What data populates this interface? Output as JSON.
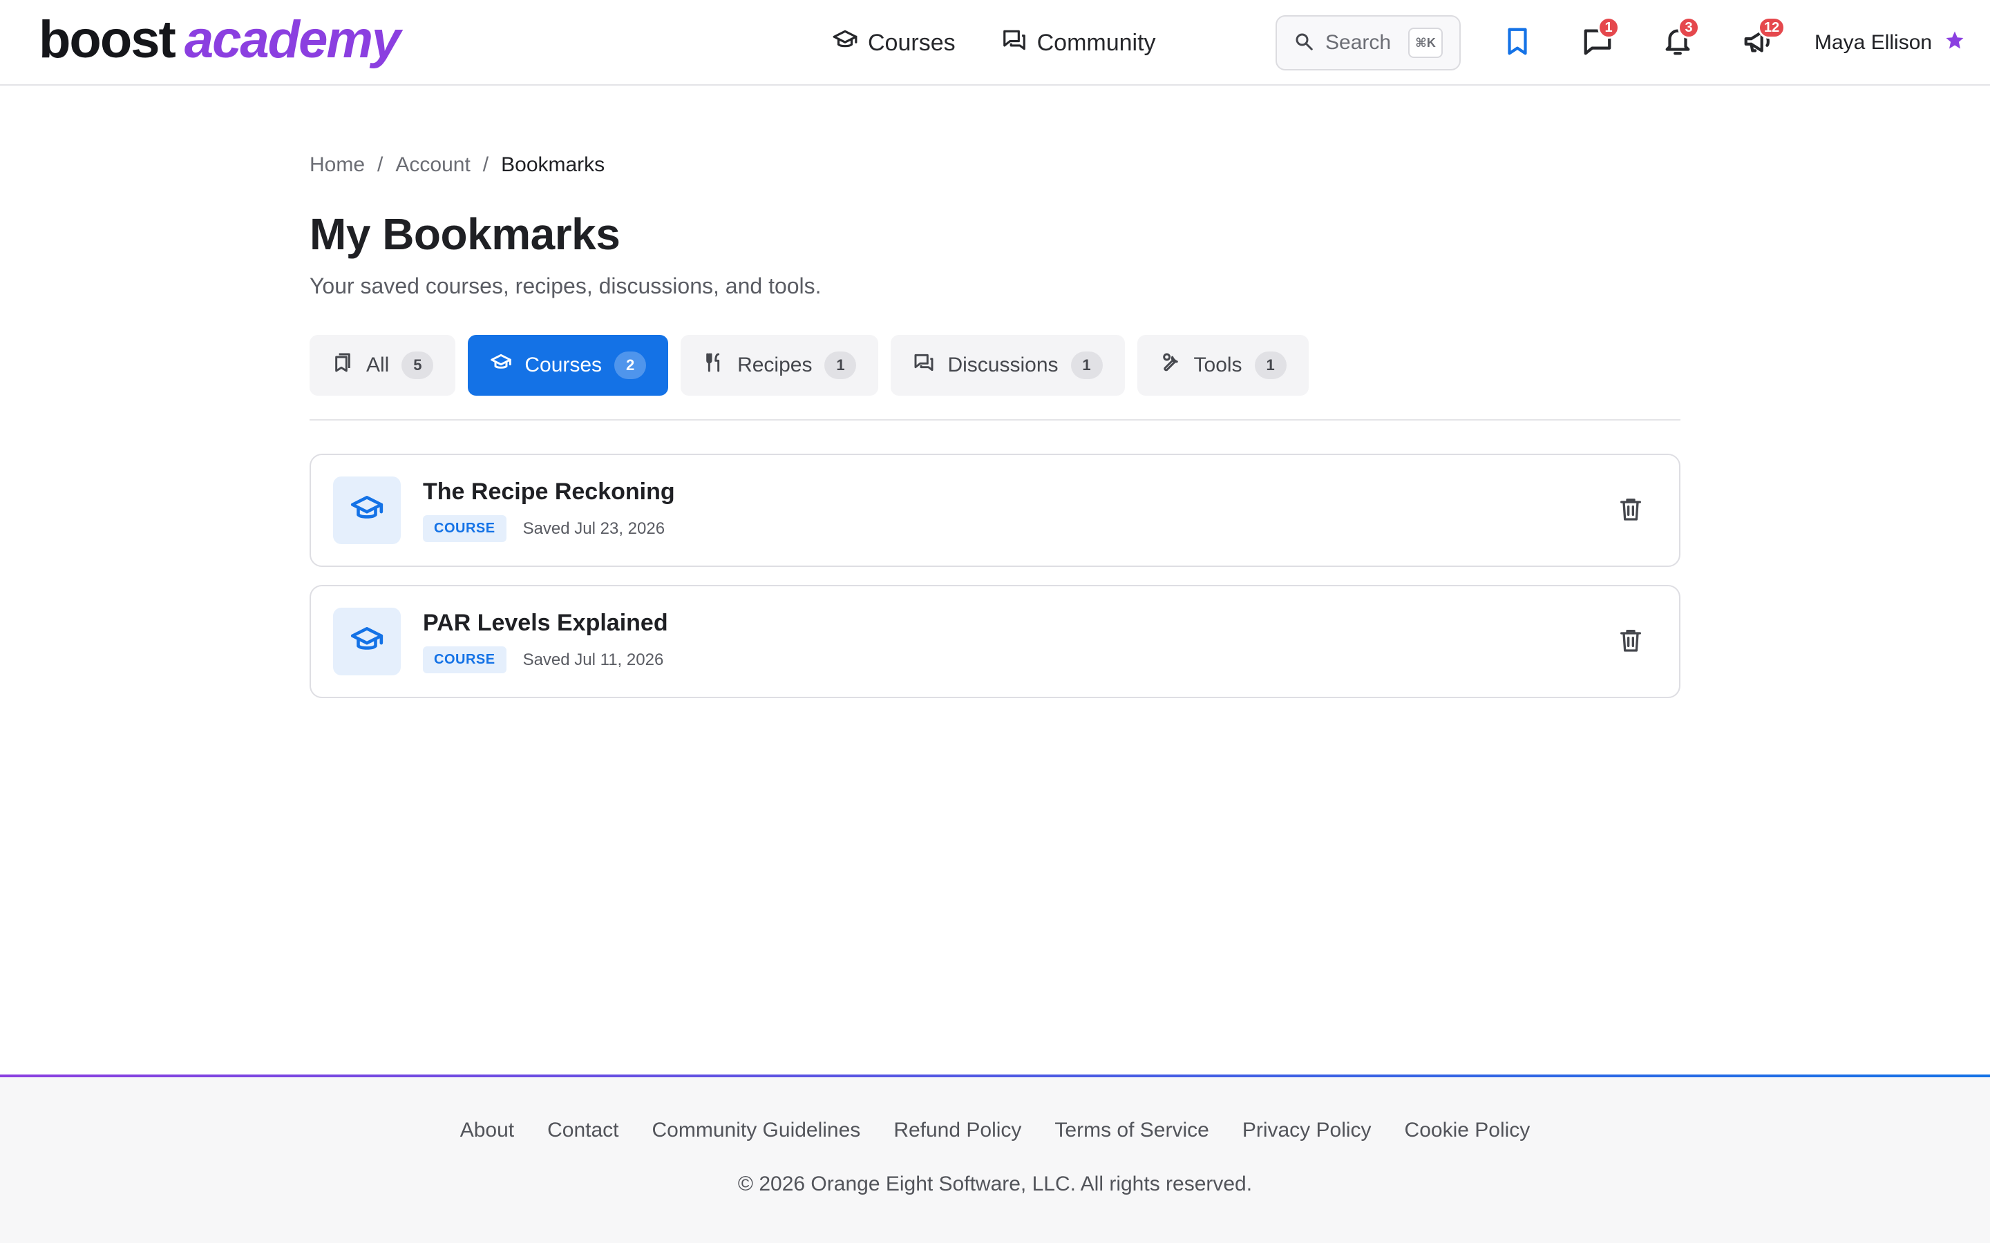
{
  "brand": {
    "name_part1": "boost",
    "name_part2": "academy",
    "primary_color": "#1472e6",
    "accent_color": "#8b3fe0"
  },
  "nav": {
    "items": [
      {
        "label": "Courses",
        "icon": "graduation-cap-icon"
      },
      {
        "label": "Community",
        "icon": "chat-bubbles-icon"
      }
    ]
  },
  "search": {
    "label": "Search",
    "shortcut": "⌘K"
  },
  "header_icons": {
    "bookmark": {
      "icon": "bookmark-icon"
    },
    "messages": {
      "icon": "message-icon",
      "badge": "1"
    },
    "notifications": {
      "icon": "bell-icon",
      "badge": "3"
    },
    "announcements": {
      "icon": "megaphone-icon",
      "badge": "12"
    }
  },
  "user": {
    "name": "Maya Ellison",
    "icon": "star-icon"
  },
  "breadcrumb": {
    "items": [
      "Home",
      "Account",
      "Bookmarks"
    ],
    "separator": "/"
  },
  "page": {
    "title": "My Bookmarks",
    "subtitle": "Your saved courses, recipes, discussions, and tools."
  },
  "tabs": [
    {
      "label": "All",
      "count": "5",
      "icon": "bookmarks-icon",
      "active": false
    },
    {
      "label": "Courses",
      "count": "2",
      "icon": "graduation-cap-icon",
      "active": true
    },
    {
      "label": "Recipes",
      "count": "1",
      "icon": "fork-knife-icon",
      "active": false
    },
    {
      "label": "Discussions",
      "count": "1",
      "icon": "chat-bubbles-icon",
      "active": false
    },
    {
      "label": "Tools",
      "count": "1",
      "icon": "wrench-icon",
      "active": false
    }
  ],
  "bookmarks": [
    {
      "title": "The Recipe Reckoning",
      "type": "COURSE",
      "saved": "Saved Jul 23, 2026"
    },
    {
      "title": "PAR Levels Explained",
      "type": "COURSE",
      "saved": "Saved Jul 11, 2026"
    }
  ],
  "footer": {
    "links": [
      "About",
      "Contact",
      "Community Guidelines",
      "Refund Policy",
      "Terms of Service",
      "Privacy Policy",
      "Cookie Policy"
    ],
    "copyright": "© 2026 Orange Eight Software, LLC. All rights reserved."
  }
}
